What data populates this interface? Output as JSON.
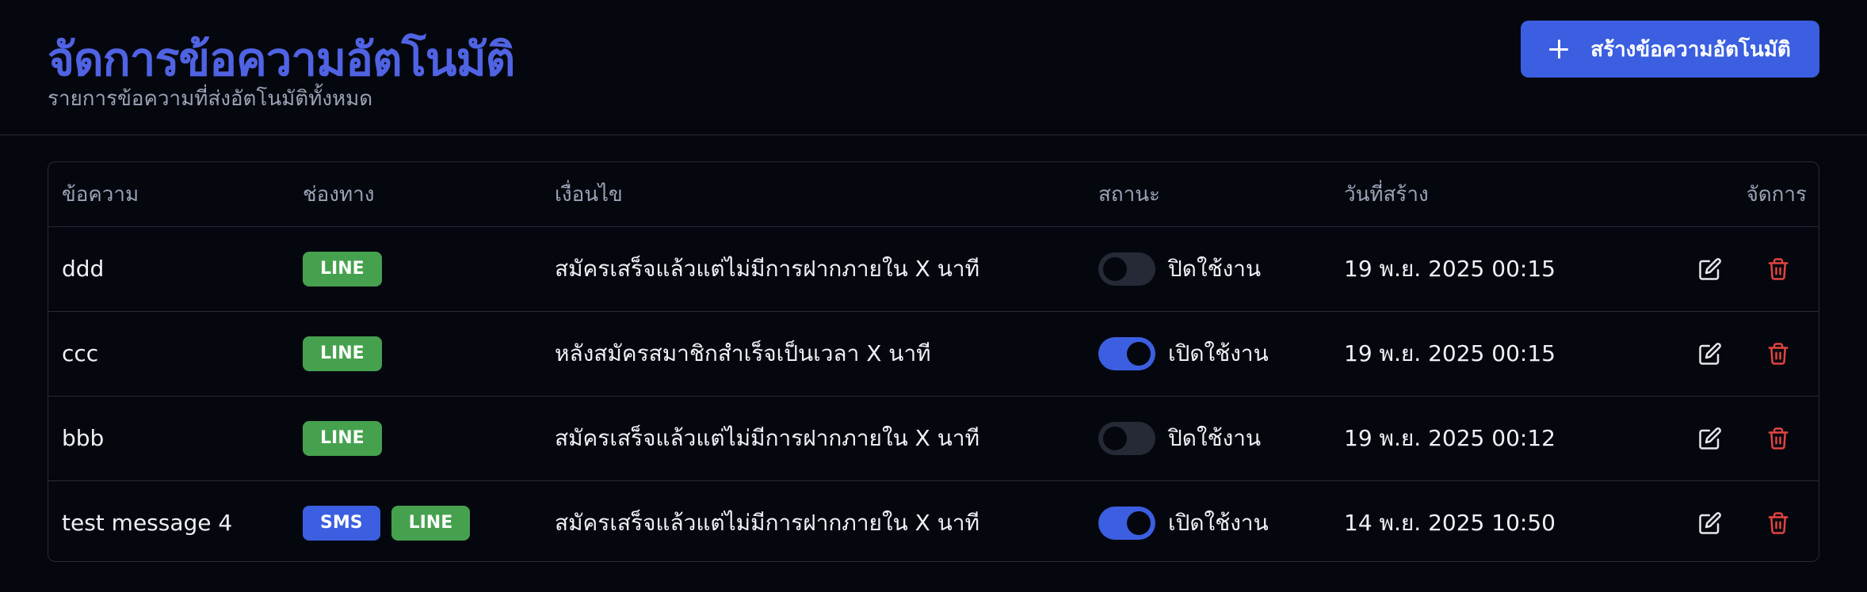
{
  "header": {
    "title": "จัดการข้อความอัตโนมัติ",
    "subtitle": "รายการข้อความที่ส่งอัตโนมัติทั้งหมด",
    "create_button_label": "สร้างข้อความอัตโนมัติ",
    "create_button_icon": "plus-icon"
  },
  "table": {
    "columns": {
      "message": "ข้อความ",
      "channel": "ช่องทาง",
      "condition": "เงื่อนไข",
      "status": "สถานะ",
      "created": "วันที่สร้าง",
      "actions": "จัดการ"
    },
    "rows": [
      {
        "message": "ddd",
        "channels": [
          "LINE"
        ],
        "condition": "สมัครเสร็จแล้วแต่ไม่มีการฝากภายใน X นาที",
        "enabled": false,
        "status_label": "ปิดใช้งาน",
        "created": "19 พ.ย. 2025 00:15"
      },
      {
        "message": "ccc",
        "channels": [
          "LINE"
        ],
        "condition": "หลังสมัครสมาชิกสำเร็จเป็นเวลา X นาที",
        "enabled": true,
        "status_label": "เปิดใช้งาน",
        "created": "19 พ.ย. 2025 00:15"
      },
      {
        "message": "bbb",
        "channels": [
          "LINE"
        ],
        "condition": "สมัครเสร็จแล้วแต่ไม่มีการฝากภายใน X นาที",
        "enabled": false,
        "status_label": "ปิดใช้งาน",
        "created": "19 พ.ย. 2025 00:12"
      },
      {
        "message": "test message 4",
        "channels": [
          "SMS",
          "LINE"
        ],
        "condition": "สมัครเสร็จแล้วแต่ไม่มีการฝากภายใน X นาที",
        "enabled": true,
        "status_label": "เปิดใช้งาน",
        "created": "14 พ.ย. 2025 10:50"
      }
    ]
  },
  "colors": {
    "accent": "#3b5fe0",
    "title": "#4f63e3",
    "line_badge": "#46a14e",
    "sms_badge": "#3b5fe0",
    "delete": "#e0443e",
    "background": "#05070f"
  },
  "icons": {
    "edit": "edit-icon",
    "delete": "trash-icon"
  }
}
